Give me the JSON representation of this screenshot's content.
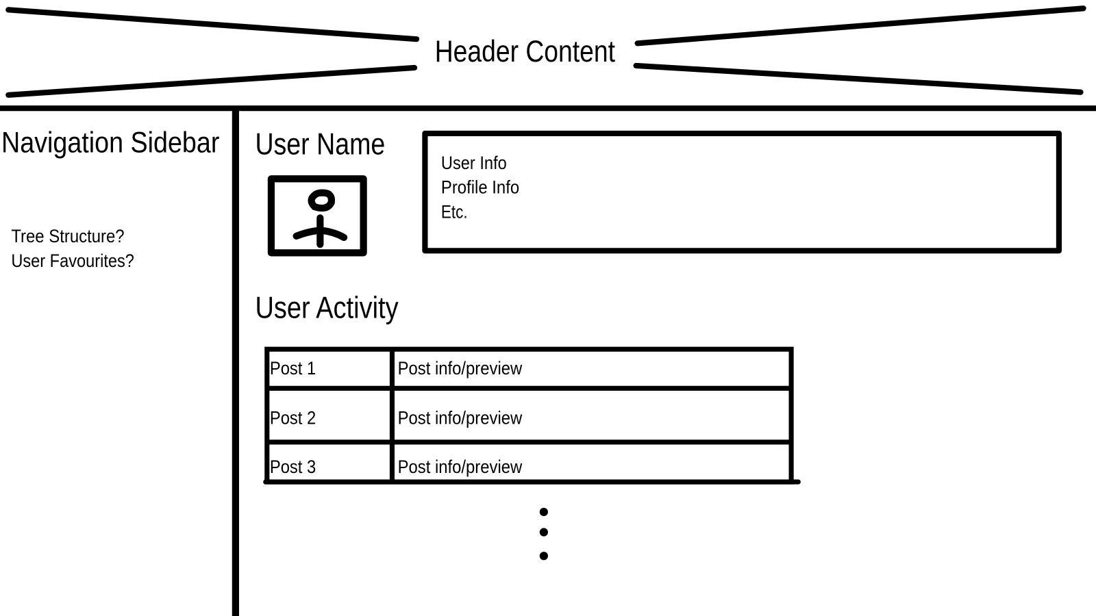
{
  "header": {
    "title": "Header Content"
  },
  "sidebar": {
    "title": "Navigation Sidebar",
    "items": [
      {
        "label": "Tree Structure?"
      },
      {
        "label": "User Favourites?"
      }
    ]
  },
  "profile": {
    "user_name": "User Name",
    "avatar_icon": "stick-figure-avatar-icon",
    "info_lines": [
      "User Info",
      "Profile Info",
      "Etc."
    ]
  },
  "activity": {
    "title": "User Activity",
    "posts": [
      {
        "title": "Post 1",
        "preview": "Post info/preview"
      },
      {
        "title": "Post 2",
        "preview": "Post info/preview"
      },
      {
        "title": "Post 3",
        "preview": "Post info/preview"
      }
    ],
    "more_icon": "vertical-ellipsis-icon"
  }
}
